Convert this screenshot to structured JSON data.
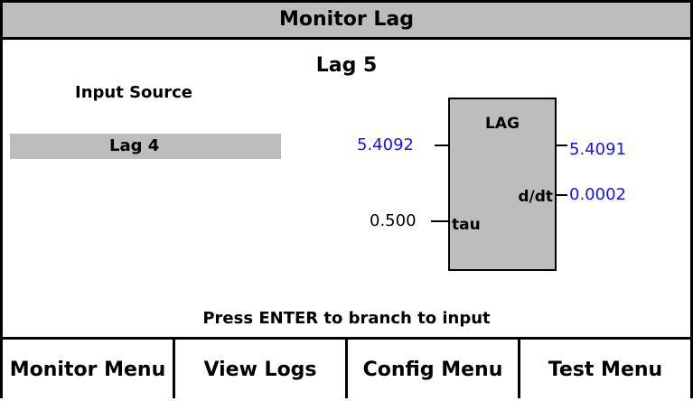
{
  "title": "Monitor Lag",
  "block_title": "Lag 5",
  "input_source": {
    "label": "Input Source",
    "value": "Lag 4"
  },
  "lag_block": {
    "name": "LAG",
    "input_value": "5.4092",
    "output_value": "5.4091",
    "derivative_label": "d/dt",
    "derivative_value": "0.0002",
    "tau_label": "tau",
    "tau_value": "0.500"
  },
  "prompt": "Press ENTER to branch to input",
  "menu": [
    {
      "label": "Monitor Menu"
    },
    {
      "label": "View Logs"
    },
    {
      "label": "Config Menu"
    },
    {
      "label": "Test Menu"
    }
  ],
  "colors": {
    "panel_gray": "#bdbdbd",
    "value_blue": "#1515e6"
  }
}
